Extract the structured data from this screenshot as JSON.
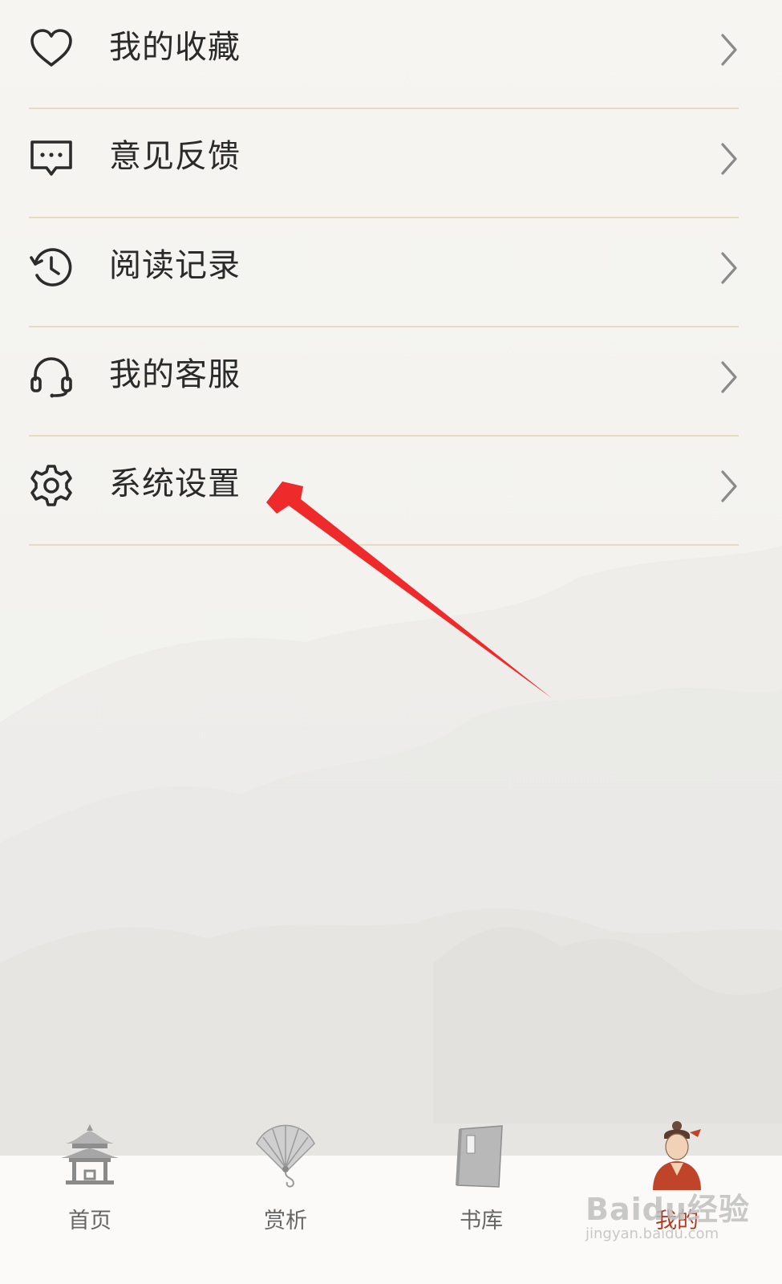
{
  "menu": {
    "items": [
      {
        "label": "我的收藏",
        "icon": "heart-icon"
      },
      {
        "label": "意见反馈",
        "icon": "feedback-message-icon"
      },
      {
        "label": "阅读记录",
        "icon": "history-icon"
      },
      {
        "label": "我的客服",
        "icon": "headset-icon"
      },
      {
        "label": "系统设置",
        "icon": "gear-icon"
      }
    ]
  },
  "tabbar": {
    "items": [
      {
        "label": "首页",
        "icon": "pavilion-icon"
      },
      {
        "label": "赏析",
        "icon": "folding-fan-icon"
      },
      {
        "label": "书库",
        "icon": "book-icon"
      },
      {
        "label": "我的",
        "icon": "scholar-avatar-icon",
        "active": true
      }
    ]
  },
  "watermark": {
    "main": "Baidu经验",
    "sub": "jingyan.baidu.com"
  },
  "colors": {
    "annotation_arrow": "#ee2a2a",
    "divider": "#e5dcc0",
    "active_tab": "#b03a22"
  }
}
